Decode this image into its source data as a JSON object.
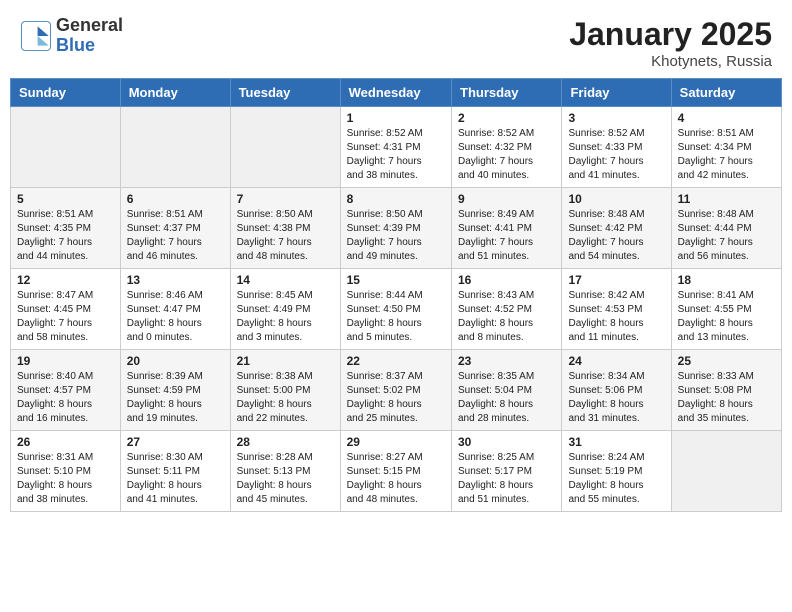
{
  "header": {
    "logo_general": "General",
    "logo_blue": "Blue",
    "month": "January 2025",
    "location": "Khotynets, Russia"
  },
  "weekdays": [
    "Sunday",
    "Monday",
    "Tuesday",
    "Wednesday",
    "Thursday",
    "Friday",
    "Saturday"
  ],
  "weeks": [
    [
      {
        "day": "",
        "info": ""
      },
      {
        "day": "",
        "info": ""
      },
      {
        "day": "",
        "info": ""
      },
      {
        "day": "1",
        "info": "Sunrise: 8:52 AM\nSunset: 4:31 PM\nDaylight: 7 hours\nand 38 minutes."
      },
      {
        "day": "2",
        "info": "Sunrise: 8:52 AM\nSunset: 4:32 PM\nDaylight: 7 hours\nand 40 minutes."
      },
      {
        "day": "3",
        "info": "Sunrise: 8:52 AM\nSunset: 4:33 PM\nDaylight: 7 hours\nand 41 minutes."
      },
      {
        "day": "4",
        "info": "Sunrise: 8:51 AM\nSunset: 4:34 PM\nDaylight: 7 hours\nand 42 minutes."
      }
    ],
    [
      {
        "day": "5",
        "info": "Sunrise: 8:51 AM\nSunset: 4:35 PM\nDaylight: 7 hours\nand 44 minutes."
      },
      {
        "day": "6",
        "info": "Sunrise: 8:51 AM\nSunset: 4:37 PM\nDaylight: 7 hours\nand 46 minutes."
      },
      {
        "day": "7",
        "info": "Sunrise: 8:50 AM\nSunset: 4:38 PM\nDaylight: 7 hours\nand 48 minutes."
      },
      {
        "day": "8",
        "info": "Sunrise: 8:50 AM\nSunset: 4:39 PM\nDaylight: 7 hours\nand 49 minutes."
      },
      {
        "day": "9",
        "info": "Sunrise: 8:49 AM\nSunset: 4:41 PM\nDaylight: 7 hours\nand 51 minutes."
      },
      {
        "day": "10",
        "info": "Sunrise: 8:48 AM\nSunset: 4:42 PM\nDaylight: 7 hours\nand 54 minutes."
      },
      {
        "day": "11",
        "info": "Sunrise: 8:48 AM\nSunset: 4:44 PM\nDaylight: 7 hours\nand 56 minutes."
      }
    ],
    [
      {
        "day": "12",
        "info": "Sunrise: 8:47 AM\nSunset: 4:45 PM\nDaylight: 7 hours\nand 58 minutes."
      },
      {
        "day": "13",
        "info": "Sunrise: 8:46 AM\nSunset: 4:47 PM\nDaylight: 8 hours\nand 0 minutes."
      },
      {
        "day": "14",
        "info": "Sunrise: 8:45 AM\nSunset: 4:49 PM\nDaylight: 8 hours\nand 3 minutes."
      },
      {
        "day": "15",
        "info": "Sunrise: 8:44 AM\nSunset: 4:50 PM\nDaylight: 8 hours\nand 5 minutes."
      },
      {
        "day": "16",
        "info": "Sunrise: 8:43 AM\nSunset: 4:52 PM\nDaylight: 8 hours\nand 8 minutes."
      },
      {
        "day": "17",
        "info": "Sunrise: 8:42 AM\nSunset: 4:53 PM\nDaylight: 8 hours\nand 11 minutes."
      },
      {
        "day": "18",
        "info": "Sunrise: 8:41 AM\nSunset: 4:55 PM\nDaylight: 8 hours\nand 13 minutes."
      }
    ],
    [
      {
        "day": "19",
        "info": "Sunrise: 8:40 AM\nSunset: 4:57 PM\nDaylight: 8 hours\nand 16 minutes."
      },
      {
        "day": "20",
        "info": "Sunrise: 8:39 AM\nSunset: 4:59 PM\nDaylight: 8 hours\nand 19 minutes."
      },
      {
        "day": "21",
        "info": "Sunrise: 8:38 AM\nSunset: 5:00 PM\nDaylight: 8 hours\nand 22 minutes."
      },
      {
        "day": "22",
        "info": "Sunrise: 8:37 AM\nSunset: 5:02 PM\nDaylight: 8 hours\nand 25 minutes."
      },
      {
        "day": "23",
        "info": "Sunrise: 8:35 AM\nSunset: 5:04 PM\nDaylight: 8 hours\nand 28 minutes."
      },
      {
        "day": "24",
        "info": "Sunrise: 8:34 AM\nSunset: 5:06 PM\nDaylight: 8 hours\nand 31 minutes."
      },
      {
        "day": "25",
        "info": "Sunrise: 8:33 AM\nSunset: 5:08 PM\nDaylight: 8 hours\nand 35 minutes."
      }
    ],
    [
      {
        "day": "26",
        "info": "Sunrise: 8:31 AM\nSunset: 5:10 PM\nDaylight: 8 hours\nand 38 minutes."
      },
      {
        "day": "27",
        "info": "Sunrise: 8:30 AM\nSunset: 5:11 PM\nDaylight: 8 hours\nand 41 minutes."
      },
      {
        "day": "28",
        "info": "Sunrise: 8:28 AM\nSunset: 5:13 PM\nDaylight: 8 hours\nand 45 minutes."
      },
      {
        "day": "29",
        "info": "Sunrise: 8:27 AM\nSunset: 5:15 PM\nDaylight: 8 hours\nand 48 minutes."
      },
      {
        "day": "30",
        "info": "Sunrise: 8:25 AM\nSunset: 5:17 PM\nDaylight: 8 hours\nand 51 minutes."
      },
      {
        "day": "31",
        "info": "Sunrise: 8:24 AM\nSunset: 5:19 PM\nDaylight: 8 hours\nand 55 minutes."
      },
      {
        "day": "",
        "info": ""
      }
    ]
  ]
}
